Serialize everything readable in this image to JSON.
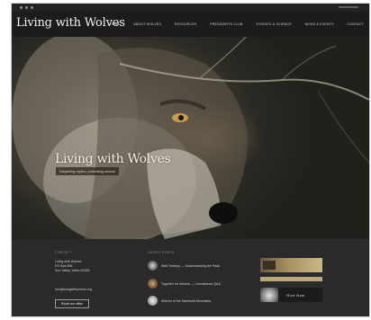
{
  "site": {
    "logo_text": "Living with Wolves",
    "social_icons": [
      "social-dot-icon",
      "social-dot-icon",
      "social-dot-icon"
    ]
  },
  "nav": {
    "items": [
      "Home",
      "About Wolves",
      "Resources",
      "Presidents Club",
      "Stories & Science",
      "News & Events",
      "Contact"
    ]
  },
  "hero": {
    "title": "Living with Wolves",
    "subtitle": "Dispelling myths, protecting wolves"
  },
  "footer": {
    "contact_heading": "Contact",
    "address_lines": [
      "Living with Wolves",
      "PO Box 896",
      "Sun Valley, Idaho 83353"
    ],
    "email": "info@livingwithwolves.org",
    "button_label": "Email our office",
    "posts_heading": "Latest Posts",
    "posts": [
      {
        "title": "Wolf Territory — Understanding the Pack"
      },
      {
        "title": "Together for Wolves — Coexistence Q&A"
      },
      {
        "title": "Wolves of the Sawtooth Mountains"
      }
    ],
    "promo_label": "Give Now"
  },
  "colors": {
    "background": "#1a1a1a",
    "navbar": "#1c1c1c",
    "footer": "#2a2a2a",
    "accent_gold": "#b9a77c"
  }
}
